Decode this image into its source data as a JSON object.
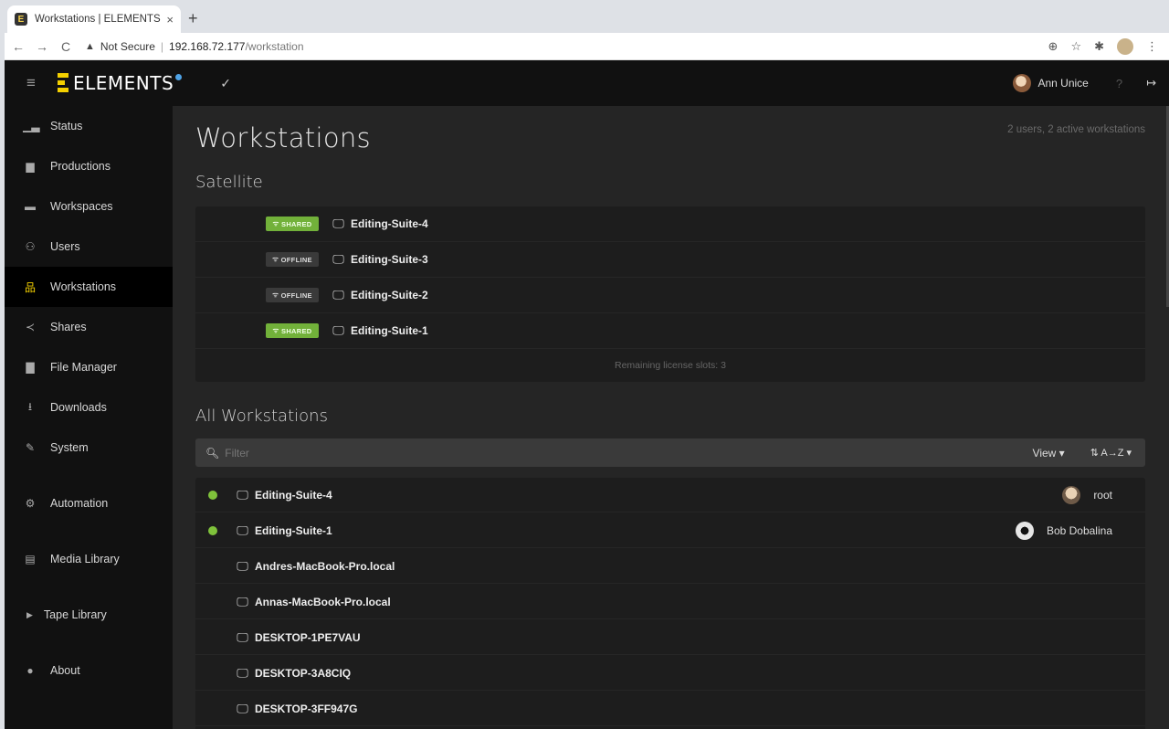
{
  "browser": {
    "tab_title": "Workstations | ELEMENTS",
    "tab_close": "×",
    "new_tab": "+",
    "security": "Not Secure",
    "url_host": "192.168.72.177",
    "url_path": "/workstation",
    "nav": {
      "back": "←",
      "forward": "→",
      "reload": "C"
    },
    "icons": {
      "zoom": "⊕",
      "bookmark": "☆",
      "extensions": "✱",
      "menu": "⋮"
    }
  },
  "header": {
    "logo_text": "ELEMENTS",
    "check": "✓",
    "user_name": "Ann Unice",
    "help": "?",
    "logout": "↦"
  },
  "sidebar": {
    "items": [
      {
        "label": "Status",
        "icon": "chart-icon",
        "glyph": "▁▃"
      },
      {
        "label": "Productions",
        "icon": "briefcase-icon",
        "glyph": "▆"
      },
      {
        "label": "Workspaces",
        "icon": "folder-icon",
        "glyph": "▬"
      },
      {
        "label": "Users",
        "icon": "users-icon",
        "glyph": "⚇"
      },
      {
        "label": "Workstations",
        "icon": "sitemap-icon",
        "glyph": "品",
        "active": true
      },
      {
        "label": "Shares",
        "icon": "share-icon",
        "glyph": "≺"
      },
      {
        "label": "File Manager",
        "icon": "file-manager-icon",
        "glyph": "▇"
      },
      {
        "label": "Downloads",
        "icon": "download-icon",
        "glyph": "⭳"
      },
      {
        "label": "System",
        "icon": "wrench-icon",
        "glyph": "✎"
      },
      {
        "label": "Automation",
        "icon": "cogs-icon",
        "glyph": "⚙"
      },
      {
        "label": "Media Library",
        "icon": "media-library-icon",
        "glyph": "▤"
      },
      {
        "label": "Tape Library",
        "icon": "caret-right-icon",
        "glyph": "▶"
      },
      {
        "label": "About",
        "icon": "info-icon",
        "glyph": "●"
      }
    ]
  },
  "page": {
    "title": "Workstations",
    "meta": "2 users, 2 active workstations"
  },
  "satellite": {
    "title": "Satellite",
    "rows": [
      {
        "status": "SHARED",
        "name": "Editing-Suite-4"
      },
      {
        "status": "OFFLINE",
        "name": "Editing-Suite-3"
      },
      {
        "status": "OFFLINE",
        "name": "Editing-Suite-2"
      },
      {
        "status": "SHARED",
        "name": "Editing-Suite-1"
      }
    ],
    "remaining": "Remaining license slots: 3"
  },
  "all_workstations": {
    "title": "All Workstations",
    "filter_placeholder": "Filter",
    "view_label": "View ▾",
    "sort_label": "⇅ A→Z ▾",
    "rows": [
      {
        "name": "Editing-Suite-4",
        "online": true,
        "user": "root"
      },
      {
        "name": "Editing-Suite-1",
        "online": true,
        "user": "Bob Dobalina"
      },
      {
        "name": "Andres-MacBook-Pro.local",
        "online": false,
        "user": ""
      },
      {
        "name": "Annas-MacBook-Pro.local",
        "online": false,
        "user": ""
      },
      {
        "name": "DESKTOP-1PE7VAU",
        "online": false,
        "user": ""
      },
      {
        "name": "DESKTOP-3A8CIQ",
        "online": false,
        "user": ""
      },
      {
        "name": "DESKTOP-3FF947G",
        "online": false,
        "user": ""
      }
    ]
  },
  "colors": {
    "accent": "#f4d000",
    "shared": "#72b13a",
    "online": "#7fc23b",
    "sidebar_bg": "#111111",
    "main_bg": "#252525"
  }
}
